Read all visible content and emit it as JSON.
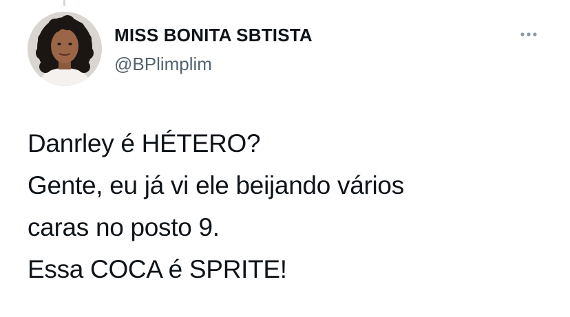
{
  "tweet": {
    "author": {
      "display_name": "MISS BONITA SBTISTA",
      "handle": "@BPlimplim",
      "avatar_icon": "profile-photo"
    },
    "more_icon": "more-options-icon",
    "text_lines": [
      "Danrley é HÉTERO?",
      "Gente, eu já vi ele beijando vários",
      "caras no posto 9.",
      "Essa COCA é SPRITE!"
    ]
  },
  "colors": {
    "text_primary": "#0f1419",
    "text_secondary": "#536471",
    "thread_line": "#cfd9de",
    "background": "#ffffff"
  }
}
